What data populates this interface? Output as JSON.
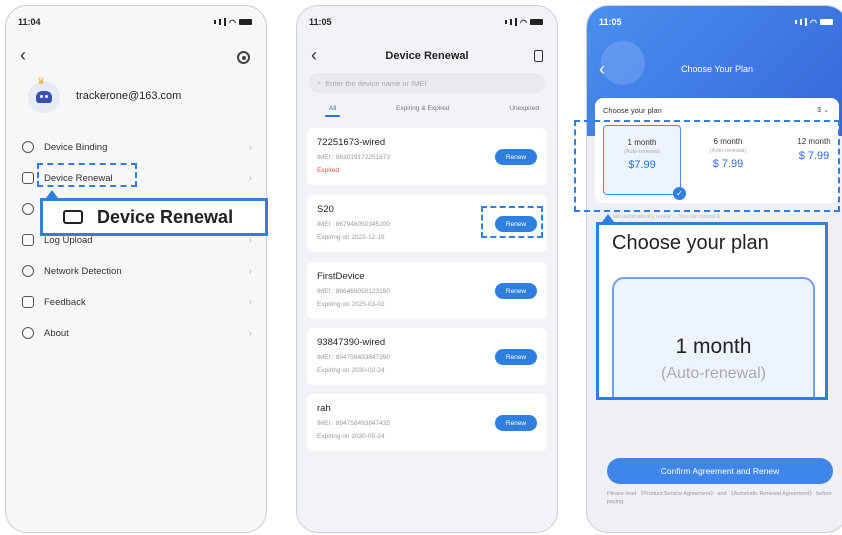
{
  "colors": {
    "accent": "#2f7fe0",
    "expired": "#e04b4b"
  },
  "phone1": {
    "time": "11:04",
    "email": "trackerone@163.com",
    "menu": [
      {
        "label": "Device Binding",
        "icon": "link-icon"
      },
      {
        "label": "Device Renewal",
        "icon": "wallet-icon"
      },
      {
        "label": "",
        "icon": "cloud-icon"
      },
      {
        "label": "Log Upload",
        "icon": "upload-icon"
      },
      {
        "label": "Network Detection",
        "icon": "network-icon"
      },
      {
        "label": "Feedback",
        "icon": "feedback-icon"
      },
      {
        "label": "About",
        "icon": "info-icon"
      }
    ],
    "callout_label": "Device Renewal"
  },
  "phone2": {
    "time": "11:05",
    "title": "Device Renewal",
    "search_placeholder": "Enter the device name or IMEI",
    "tabs": [
      "All",
      "Expiring & Expired",
      "Unexpired"
    ],
    "renew_label": "Renew",
    "devices": [
      {
        "name": "72251673-wired",
        "imei": "IMEI : 863019172251673",
        "status": "Expired"
      },
      {
        "name": "S20",
        "imei": "IMEI : 867946050345200",
        "status": "Expiring on 2022-12-18"
      },
      {
        "name": "FirstDevice",
        "imei": "IMEI : 866469050123160",
        "status": "Expiring on 2025-03-02"
      },
      {
        "name": "93847390-wired",
        "imei": "IMEI : 894758493847390",
        "status": "Expiring on 2030-02-24"
      },
      {
        "name": "rah",
        "imei": "IMEI : 894758493847435",
        "status": "Expiring on 2030-05-24"
      }
    ]
  },
  "phone3": {
    "time": "11:05",
    "title": "Choose Your Plan",
    "panel_head": "Choose your plan",
    "panel_s": "$ ⌄",
    "plans": [
      {
        "month": "1 month",
        "auto": "(Auto-renewal)",
        "price": "$7.99"
      },
      {
        "month": "6 month",
        "auto": "(Auto-renewal)",
        "price": "$ 7.99"
      },
      {
        "month": "12 month",
        "auto": "",
        "price": "$ 7.99"
      }
    ],
    "note": "... will automatically renew ... You can cancel it",
    "confirm_label": "Confirm Agreement and Renew",
    "agreement_text": "Please read 《Product Service Agreement》 and 《Automatic Renewal Agreement》 before paying"
  },
  "zoom": {
    "heading": "Choose your plan",
    "month": "1 month",
    "auto": "(Auto-renewal)"
  }
}
